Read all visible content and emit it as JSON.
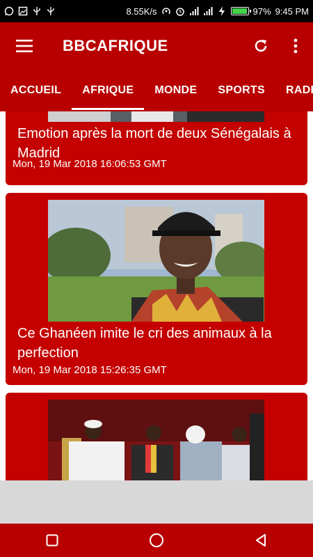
{
  "status_bar": {
    "left_icons": [
      "whatsapp-icon",
      "image-icon",
      "usb-icon",
      "usb-icon"
    ],
    "net_speed": "8.55K/s",
    "right_icons": [
      "nfc-icon",
      "alarm-icon",
      "signal-icon",
      "signal-icon",
      "charging-icon"
    ],
    "battery_percent": "97%",
    "battery_level": 0.97,
    "time": "9:45 PM"
  },
  "app_bar": {
    "title": "BBCAFRIQUE",
    "menu_icon": "hamburger-menu-icon",
    "refresh_icon": "refresh-icon",
    "more_icon": "more-vert-icon"
  },
  "tabs": [
    {
      "label": "ACCUEIL",
      "active": false
    },
    {
      "label": "AFRIQUE",
      "active": true
    },
    {
      "label": "MONDE",
      "active": false
    },
    {
      "label": "SPORTS",
      "active": false
    },
    {
      "label": "RADIO",
      "active": false
    }
  ],
  "articles": [
    {
      "title": "Emotion après la mort de deux Sénégalais à Madrid",
      "date": "Mon, 19 Mar 2018 16:06:53 GMT"
    },
    {
      "title": "Ce Ghanéen imite le cri des animaux à la perfection",
      "date": "Mon, 19 Mar 2018 15:26:35 GMT"
    },
    {
      "title": "",
      "date": ""
    }
  ],
  "nav_bar": {
    "icons": [
      "recent-apps-icon",
      "home-icon",
      "back-icon"
    ]
  },
  "colors": {
    "brand": "#b80000",
    "card": "#c40000",
    "battery": "#43d34a"
  }
}
